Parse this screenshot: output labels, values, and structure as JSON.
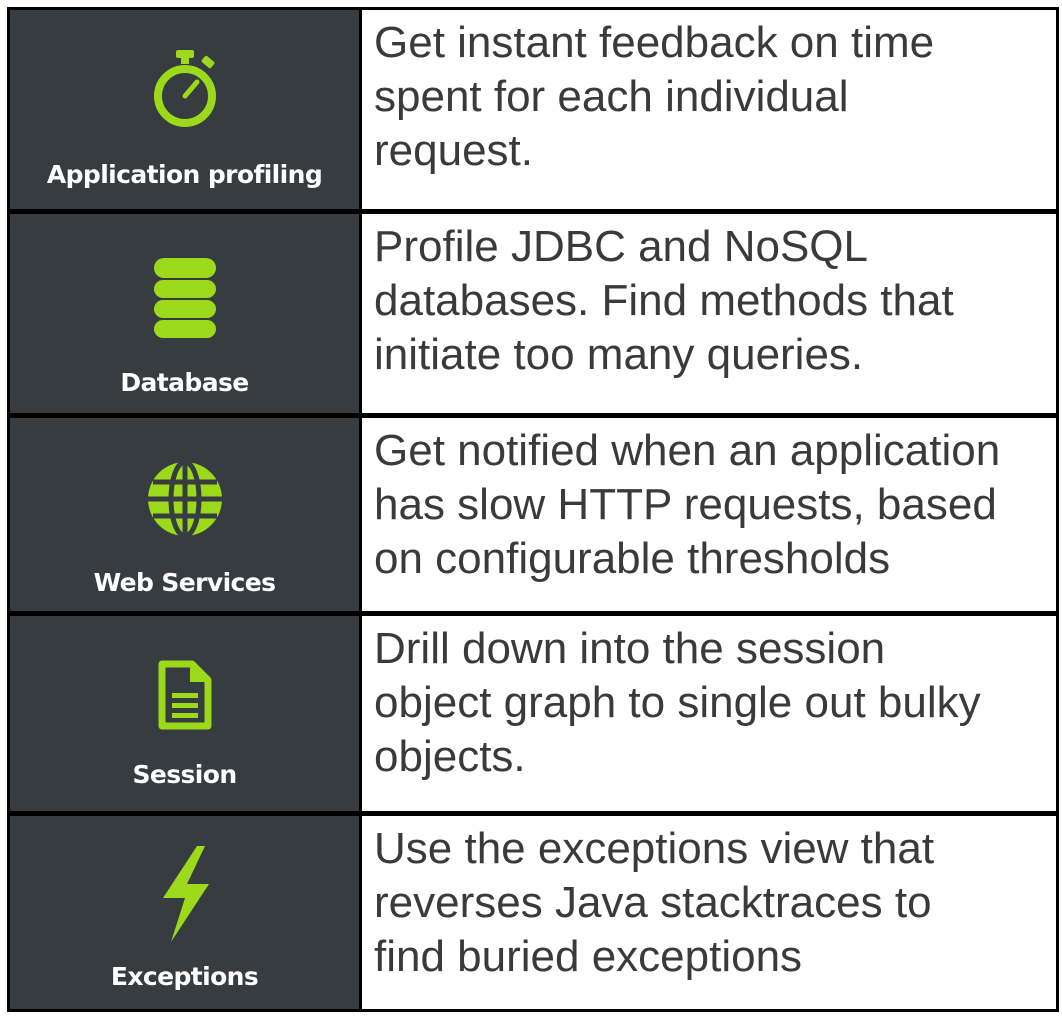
{
  "accent_color": "#9bd91a",
  "panel_color": "#373c40",
  "features": [
    {
      "icon": "stopwatch-icon",
      "label": "Application profiling",
      "description": "Get instant feedback on time\nspent for each individual\nrequest."
    },
    {
      "icon": "database-icon",
      "label": "Database",
      "description": "Profile JDBC and NoSQL\ndatabases. Find methods that\ninitiate too many queries."
    },
    {
      "icon": "globe-icon",
      "label": "Web Services",
      "description": "Get notified when an application\nhas slow HTTP requests, based\non configurable thresholds"
    },
    {
      "icon": "document-icon",
      "label": "Session",
      "description": "Drill down into the session\nobject graph to single out bulky\nobjects."
    },
    {
      "icon": "lightning-bolt-icon",
      "label": "Exceptions",
      "description": "Use the exceptions view that\nreverses Java stacktraces to\nfind buried exceptions"
    }
  ]
}
